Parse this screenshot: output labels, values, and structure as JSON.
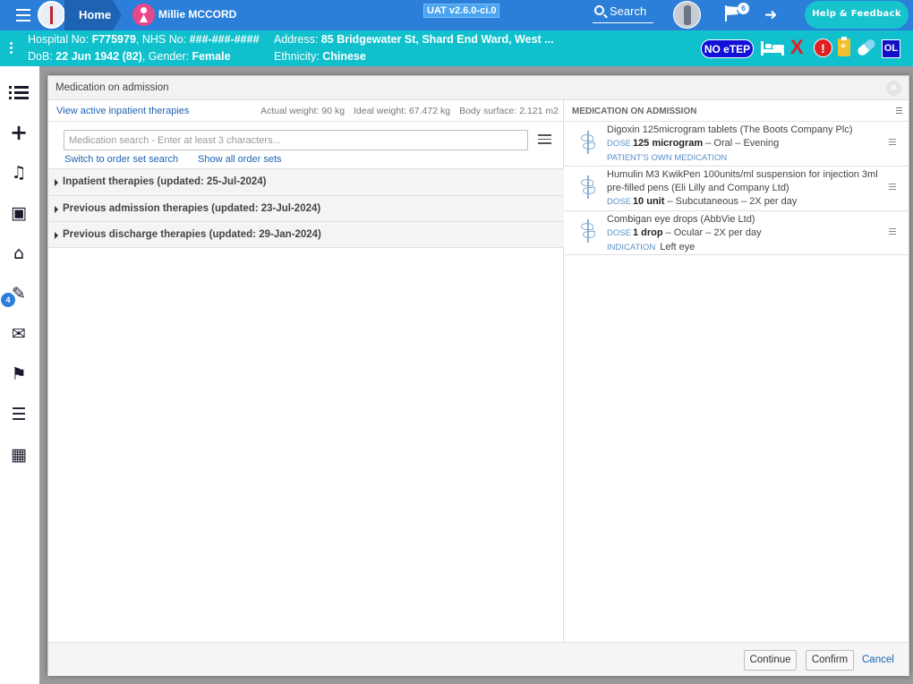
{
  "topbar": {
    "home_label": "Home",
    "patient_name": "Millie MCCORD",
    "version": "UAT v2.6.0-ci.0",
    "search_label": "Search",
    "flag_count": "6",
    "help_label": "Help & Feedback"
  },
  "banner": {
    "hospital_label": "Hospital No: ",
    "hospital_no": "F775979",
    "nhs_label": ", NHS No: ",
    "nhs_no": "###-###-####",
    "address_label": "Address: ",
    "address": "85 Bridgewater St, Shard End Ward, West ...",
    "dob_label": "DoB: ",
    "dob": "22 Jun 1942 (82)",
    "gender_label": ", Gender: ",
    "gender": "Female",
    "ethnicity_label": "Ethnicity: ",
    "ethnicity": "Chinese",
    "noetep": "NO eTEP",
    "alert_mark": "!",
    "x_mark": "X",
    "ol": "OL"
  },
  "rail": {
    "badge_count": "4"
  },
  "modal": {
    "title": "Medication on admission",
    "view_active_link": "View active inpatient therapies",
    "actual_weight": "Actual weight: 90 kg",
    "ideal_weight": "Ideal weight: 67.472 kg",
    "body_surface": "Body surface: 2.121 m2",
    "search_placeholder": "Medication search - Enter at least 3 characters...",
    "search_value": "",
    "switch_link": "Switch to order set search",
    "show_all_link": "Show all order sets",
    "sections": [
      "Inpatient therapies (updated: 25-Jul-2024)",
      "Previous admission therapies (updated: 23-Jul-2024)",
      "Previous discharge therapies (updated: 29-Jan-2024)"
    ],
    "right_title": "MEDICATION ON ADMISSION",
    "dose_key": "DOSE",
    "indication_key": "INDICATION",
    "meds": [
      {
        "name": "Digoxin 125microgram tablets (The Boots Company Plc)",
        "dose": "125 microgram",
        "route": " – Oral – Evening",
        "note": "PATIENT'S OWN MEDICATION"
      },
      {
        "name": "Humulin M3 KwikPen 100units/ml suspension for injection 3ml pre-filled pens (Eli Lilly and Company Ltd)",
        "dose": "10 unit",
        "route": " – Subcutaneous – 2X per day"
      },
      {
        "name": "Combigan eye drops (AbbVie Ltd)",
        "dose": "1 drop",
        "route": " – Ocular – 2X per day",
        "indication": "Left eye"
      }
    ],
    "continue_label": "Continue",
    "confirm_label": "Confirm",
    "cancel_label": "Cancel"
  }
}
